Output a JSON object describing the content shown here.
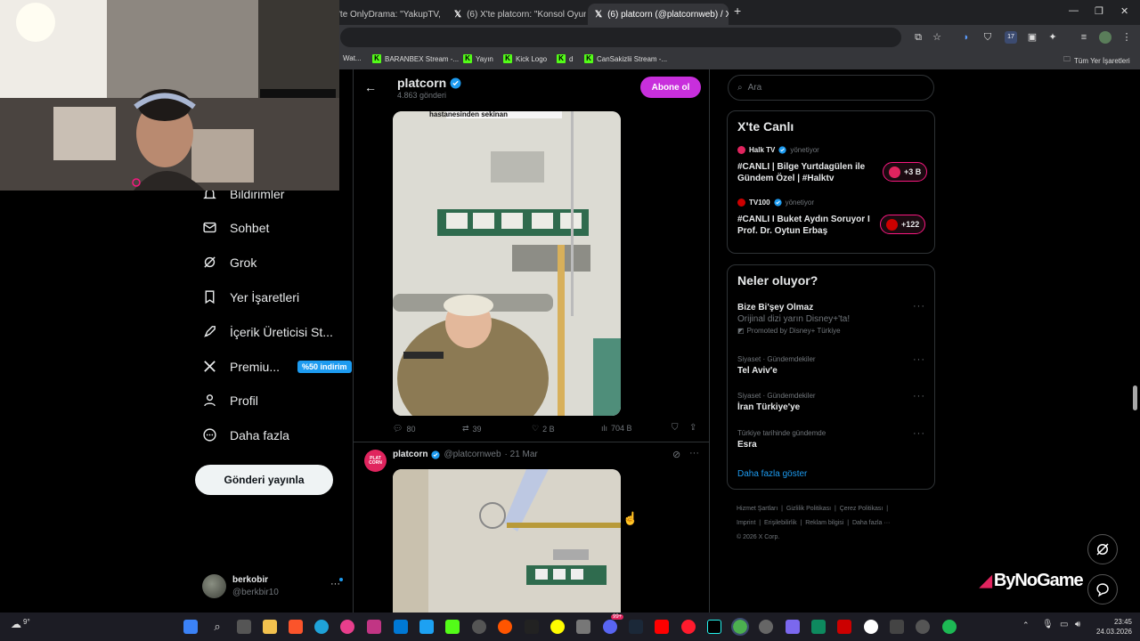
{
  "browser": {
    "tabs": [
      {
        "title": "'te OnlyDrama: \"YakupTV,"
      },
      {
        "title": "(6) X'te platcorn: \"Konsol Oyun"
      },
      {
        "title": "(6) platcorn (@platcornweb) / X"
      }
    ],
    "bookmarks": [
      "Wat...",
      "BARANBEX Stream -...",
      "Yayın",
      "Kick Logo",
      "d",
      "CanSakizlii Stream -..."
    ],
    "all_bookmarks": "Tüm Yer İşaretleri",
    "ext_badge": "17"
  },
  "nav": {
    "items": [
      {
        "label": "Bildirimler"
      },
      {
        "label": "Sohbet"
      },
      {
        "label": "Grok"
      },
      {
        "label": "Yer İşaretleri"
      },
      {
        "label": "İçerik Üreticisi St..."
      },
      {
        "label": "Premiu..."
      },
      {
        "label": "Profil"
      },
      {
        "label": "Daha fazla"
      }
    ],
    "premium_badge": "%50 indirim",
    "post_button": "Gönderi yayınla",
    "account": {
      "name": "berkobir",
      "handle": "@berkbir10"
    }
  },
  "profile_header": {
    "name": "platcorn",
    "posts": "4.863 gönderi",
    "subscribe": "Abone ol"
  },
  "post1": {
    "image_caption": "hastanesinden sekinan",
    "actions": {
      "replies": "80",
      "reposts": "39",
      "likes": "2 B",
      "views": "704 B"
    }
  },
  "post2": {
    "name": "platcorn",
    "handle": "@platcornweb",
    "date": "· 21 Mar",
    "avatar_text": "PLAT CORN"
  },
  "search": {
    "placeholder": "Ara"
  },
  "live": {
    "title": "X'te Canlı",
    "items": [
      {
        "host": "Halk TV",
        "managed": "yönetiyor",
        "title": "#CANLI | Bilge Yurtdagülen ile Gündem Özel | #Halktv",
        "count": "+3 B"
      },
      {
        "host": "TV100",
        "managed": "yönetiyor",
        "title": "#CANLI I Buket Aydın Soruyor I Prof. Dr. Oytun Erbaş",
        "count": "+122"
      }
    ]
  },
  "trends": {
    "title": "Neler oluyor?",
    "items": [
      {
        "name": "Bize Bi'şey Olmaz",
        "sub": "Orijinal dizi yarın Disney+'ta!",
        "promo": "Promoted by Disney+ Türkiye"
      },
      {
        "context": "Siyaset · Gündemdekiler",
        "name": "Tel Aviv'e"
      },
      {
        "context": "Siyaset · Gündemdekiler",
        "name": "İran Türkiye'ye"
      },
      {
        "context": "Türkiye tarihinde gündemde",
        "name": "Esra"
      }
    ],
    "show_more": "Daha fazla göster"
  },
  "footer": {
    "links": [
      "Hizmet Şartları",
      "Gizlilik Politikası",
      "Çerez Politikası",
      "Imprint",
      "Erişilebilirlik",
      "Reklam bilgisi",
      "Daha fazla ···"
    ],
    "copyright": "© 2026 X Corp."
  },
  "watermark": "ByNoGame",
  "taskbar": {
    "weather": "9°",
    "time": "23:45",
    "date": "24.03.2026",
    "badge": "99+"
  },
  "colors": {
    "accent": "#1d9bf0",
    "subscribe": "#c82fdc",
    "live": "#f91880",
    "background": "#000000"
  }
}
